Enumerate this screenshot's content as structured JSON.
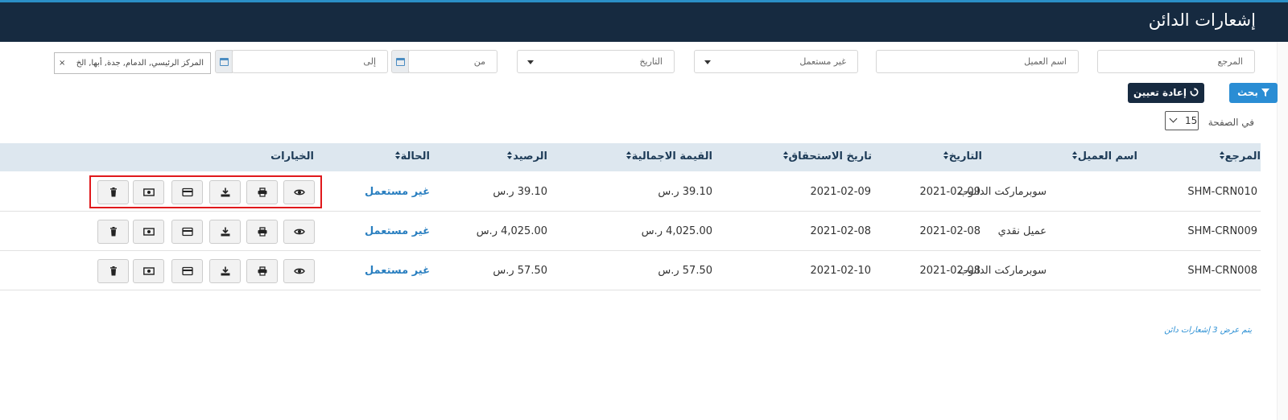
{
  "header": {
    "title": "إشعارات الدائن"
  },
  "filters": {
    "reference_placeholder": "المرجع",
    "customer_placeholder": "اسم العميل",
    "status_value": "غير مستعمل",
    "date_type_value": "التاريخ",
    "from_placeholder": "من",
    "to_placeholder": "إلى",
    "branches_value": "المركز الرئيسي, الدمام, جدة, أبها, الخ",
    "branches_clear": "×"
  },
  "buttons": {
    "search": "بحث",
    "reset": "إعادة تعيين"
  },
  "pagination": {
    "per_page_label": "في الصفحة",
    "per_page_value": "15"
  },
  "table": {
    "columns": {
      "reference": "المرجع",
      "customer": "اسم العميل",
      "date": "التاريخ",
      "due_date": "تاريخ الاستحقاق",
      "total": "القيمة الاجمالية",
      "balance": "الرصيد",
      "status": "الحالة",
      "options": "الخيارات"
    },
    "rows": [
      {
        "reference": "SHM-CRN010",
        "customer": "سوبرماركت الدانوب",
        "date": "2021-02-09",
        "due_date": "2021-02-09",
        "total": "39.10 ر.س",
        "balance": "39.10 ر.س",
        "status": "غير مستعمل"
      },
      {
        "reference": "SHM-CRN009",
        "customer": "عميل نقدي",
        "date": "2021-02-08",
        "due_date": "2021-02-08",
        "total": "4,025.00 ر.س",
        "balance": "4,025.00 ر.س",
        "status": "غير مستعمل"
      },
      {
        "reference": "SHM-CRN008",
        "customer": "سوبرماركت الدانوب",
        "date": "2021-02-08",
        "due_date": "2021-02-10",
        "total": "57.50 ر.س",
        "balance": "57.50 ر.س",
        "status": "غير مستعمل"
      }
    ]
  },
  "footer": {
    "summary": "يتم عرض 3 إشعارات دائن"
  },
  "colors": {
    "header_bg": "#162a40",
    "accent": "#2a8dd4",
    "highlight": "#e0191c",
    "table_header_bg": "#dde7ef"
  }
}
